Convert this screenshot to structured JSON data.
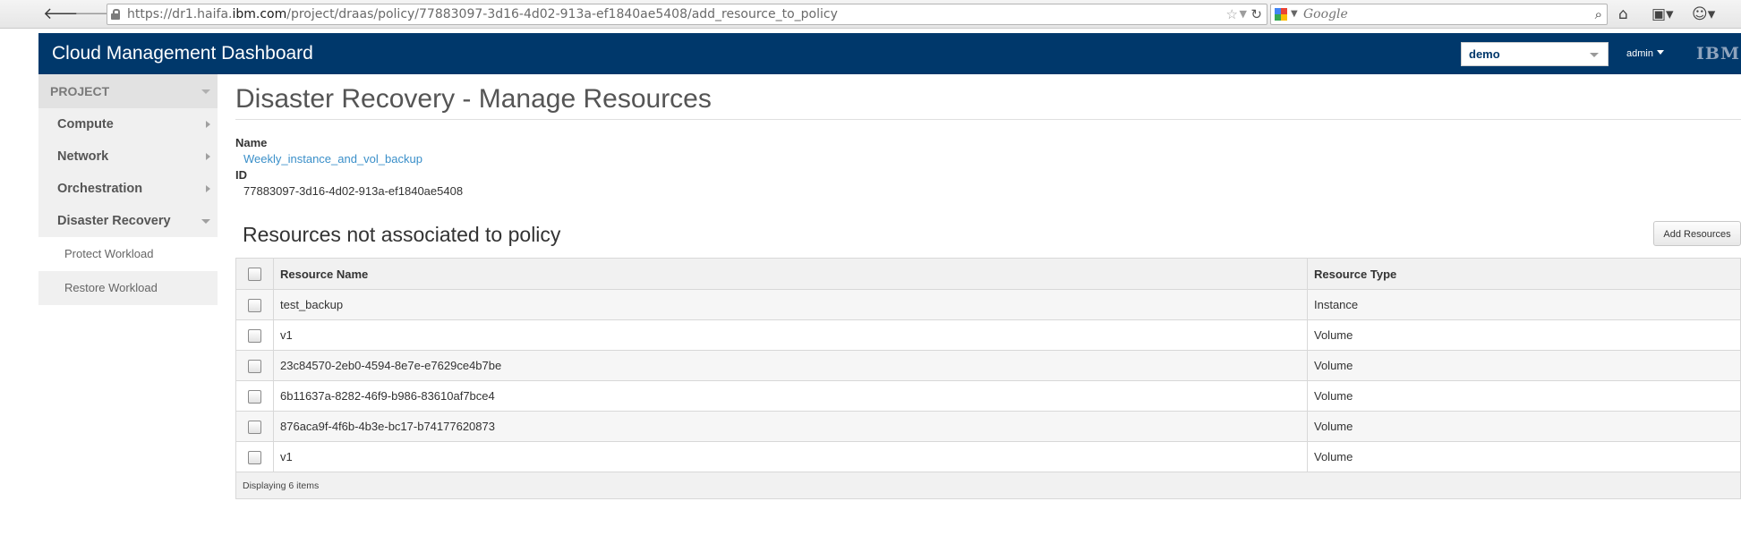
{
  "browser": {
    "url_prefix": "https://dr1.haifa.",
    "url_domain": "ibm.com",
    "url_path": "/project/draas/policy/77883097-3d16-4d02-913a-ef1840ae5408/add_resource_to_policy",
    "search_placeholder": "Google"
  },
  "header": {
    "brand": "Cloud Management Dashboard",
    "project_selected": "demo",
    "user": "admin",
    "logo": "IBM."
  },
  "sidebar": {
    "section": "PROJECT",
    "groups": [
      {
        "label": "Compute"
      },
      {
        "label": "Network"
      },
      {
        "label": "Orchestration"
      },
      {
        "label": "Disaster Recovery"
      }
    ],
    "sub_items": [
      {
        "label": "Protect Workload"
      },
      {
        "label": "Restore Workload"
      }
    ]
  },
  "main": {
    "title": "Disaster Recovery - Manage Resources",
    "name_label": "Name",
    "name_value": "Weekly_instance_and_vol_backup",
    "id_label": "ID",
    "id_value": "77883097-3d16-4d02-913a-ef1840ae5408",
    "table_title": "Resources not associated to policy",
    "add_button": "Add Resources",
    "columns": [
      "Resource Name",
      "Resource Type"
    ],
    "rows": [
      {
        "name": "test_backup",
        "type": "Instance"
      },
      {
        "name": "v1",
        "type": "Volume"
      },
      {
        "name": "23c84570-2eb0-4594-8e7e-e7629ce4b7be",
        "type": "Volume"
      },
      {
        "name": "6b11637a-8282-46f9-b986-83610af7bce4",
        "type": "Volume"
      },
      {
        "name": "876aca9f-4f6b-4b3e-bc17-b74177620873",
        "type": "Volume"
      },
      {
        "name": "v1",
        "type": "Volume"
      }
    ],
    "footer": "Displaying 6 items"
  },
  "colors": {
    "header_bg": "#00386b",
    "link": "#3a8fc9"
  }
}
